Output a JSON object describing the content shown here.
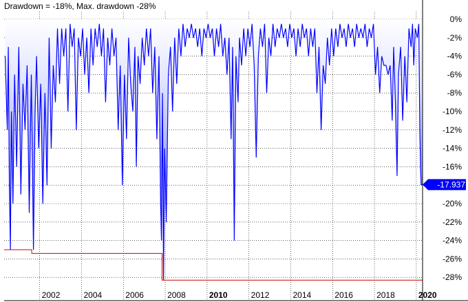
{
  "chart_data": {
    "type": "area",
    "title": "Drawdown = -18%, Max. drawdown -28%",
    "ylim": [
      -28.5,
      0
    ],
    "y_ticks": [
      0,
      -2,
      -4,
      -6,
      -8,
      -10,
      -12,
      -14,
      -16,
      -18,
      -20,
      -22,
      -24,
      -26,
      -28
    ],
    "y_tick_labels": [
      "0%",
      "-2%",
      "-4%",
      "-6%",
      "-8%",
      "-10%",
      "-12%",
      "-14%",
      "-16%",
      "-18%",
      "-20%",
      "-22%",
      "-24%",
      "-26%",
      "-28%"
    ],
    "x_range": [
      2000.3,
      2020.3
    ],
    "x_ticks": [
      2002,
      2004,
      2006,
      2008,
      2010,
      2012,
      2014,
      2016,
      2018,
      2020
    ],
    "x_tick_labels": [
      "2002",
      "2004",
      "2006",
      "2008",
      "2010",
      "2012",
      "2014",
      "2016",
      "2018",
      "2020"
    ],
    "bold_ticks": [
      "2010",
      "2020"
    ],
    "last_value": -17.937,
    "last_value_label": "-17.937",
    "series": [
      {
        "type": "line",
        "color": "#0000FF",
        "points": [
          [
            2000.35,
            -4
          ],
          [
            2000.45,
            -12
          ],
          [
            2000.5,
            -3
          ],
          [
            2000.55,
            -18
          ],
          [
            2000.6,
            -25
          ],
          [
            2000.65,
            -10
          ],
          [
            2000.72,
            -20
          ],
          [
            2000.8,
            -6
          ],
          [
            2000.9,
            -16
          ],
          [
            2001.0,
            -3
          ],
          [
            2001.1,
            -19
          ],
          [
            2001.2,
            -7
          ],
          [
            2001.3,
            -12
          ],
          [
            2001.4,
            -5
          ],
          [
            2001.5,
            -21
          ],
          [
            2001.6,
            -6
          ],
          [
            2001.7,
            -25
          ],
          [
            2001.78,
            -10
          ],
          [
            2001.85,
            -4
          ],
          [
            2001.95,
            -14
          ],
          [
            2002.05,
            -7
          ],
          [
            2002.15,
            -20
          ],
          [
            2002.25,
            -8
          ],
          [
            2002.35,
            -18
          ],
          [
            2002.45,
            -2
          ],
          [
            2002.55,
            -14
          ],
          [
            2002.65,
            -5
          ],
          [
            2002.75,
            -9
          ],
          [
            2002.85,
            -1
          ],
          [
            2002.95,
            -7
          ],
          [
            2003.05,
            -1
          ],
          [
            2003.15,
            -4
          ],
          [
            2003.25,
            -1
          ],
          [
            2003.35,
            -10
          ],
          [
            2003.45,
            -0.5
          ],
          [
            2003.55,
            -3
          ],
          [
            2003.65,
            -1
          ],
          [
            2003.75,
            -12
          ],
          [
            2003.85,
            -2
          ],
          [
            2003.95,
            -4
          ],
          [
            2004.05,
            -1
          ],
          [
            2004.15,
            -6
          ],
          [
            2004.25,
            -2
          ],
          [
            2004.35,
            -8
          ],
          [
            2004.45,
            -1
          ],
          [
            2004.55,
            -5
          ],
          [
            2004.65,
            -1
          ],
          [
            2004.75,
            -3
          ],
          [
            2004.85,
            -0.5
          ],
          [
            2004.95,
            -4
          ],
          [
            2005.05,
            -1
          ],
          [
            2005.15,
            -9
          ],
          [
            2005.25,
            -2
          ],
          [
            2005.35,
            -5
          ],
          [
            2005.45,
            -1
          ],
          [
            2005.55,
            -4
          ],
          [
            2005.65,
            -2
          ],
          [
            2005.75,
            -12
          ],
          [
            2005.85,
            -5
          ],
          [
            2005.95,
            -18
          ],
          [
            2006.05,
            -6
          ],
          [
            2006.15,
            -13
          ],
          [
            2006.25,
            -2
          ],
          [
            2006.35,
            -7
          ],
          [
            2006.45,
            -10
          ],
          [
            2006.55,
            -3
          ],
          [
            2006.62,
            -16
          ],
          [
            2006.7,
            -4
          ],
          [
            2006.8,
            -7
          ],
          [
            2006.9,
            -2
          ],
          [
            2007.0,
            -5
          ],
          [
            2007.1,
            -1
          ],
          [
            2007.2,
            -4
          ],
          [
            2007.3,
            -1
          ],
          [
            2007.4,
            -8
          ],
          [
            2007.5,
            -3
          ],
          [
            2007.6,
            -13
          ],
          [
            2007.7,
            -4
          ],
          [
            2007.78,
            -20
          ],
          [
            2007.82,
            -24
          ],
          [
            2007.87,
            -8
          ],
          [
            2007.92,
            -28.3
          ],
          [
            2007.97,
            -14
          ],
          [
            2008.05,
            -22
          ],
          [
            2008.15,
            -6
          ],
          [
            2008.25,
            -3
          ],
          [
            2008.35,
            -10
          ],
          [
            2008.45,
            -2
          ],
          [
            2008.55,
            -7
          ],
          [
            2008.65,
            -1
          ],
          [
            2008.75,
            -4
          ],
          [
            2008.85,
            -0.5
          ],
          [
            2008.95,
            -3
          ],
          [
            2009.05,
            -1
          ],
          [
            2009.15,
            -2
          ],
          [
            2009.25,
            -0.5
          ],
          [
            2009.35,
            -2
          ],
          [
            2009.45,
            -1
          ],
          [
            2009.55,
            -3
          ],
          [
            2009.65,
            -1
          ],
          [
            2009.75,
            -4
          ],
          [
            2009.85,
            -1
          ],
          [
            2009.95,
            -2
          ],
          [
            2010.05,
            -0.5
          ],
          [
            2010.15,
            -2
          ],
          [
            2010.25,
            -1
          ],
          [
            2010.35,
            -4
          ],
          [
            2010.45,
            -1
          ],
          [
            2010.55,
            -3
          ],
          [
            2010.65,
            -0.5
          ],
          [
            2010.75,
            -4
          ],
          [
            2010.85,
            -2
          ],
          [
            2010.95,
            -6
          ],
          [
            2011.05,
            -2
          ],
          [
            2011.15,
            -13
          ],
          [
            2011.22,
            -3
          ],
          [
            2011.3,
            -24
          ],
          [
            2011.38,
            -4
          ],
          [
            2011.48,
            -9
          ],
          [
            2011.55,
            -2
          ],
          [
            2011.65,
            -5
          ],
          [
            2011.75,
            -1
          ],
          [
            2011.85,
            -4
          ],
          [
            2011.95,
            -1
          ],
          [
            2012.05,
            -3
          ],
          [
            2012.15,
            -0.5
          ],
          [
            2012.25,
            -5
          ],
          [
            2012.35,
            -15
          ],
          [
            2012.45,
            -4
          ],
          [
            2012.55,
            -1
          ],
          [
            2012.65,
            -3
          ],
          [
            2012.75,
            -0.5
          ],
          [
            2012.85,
            -8
          ],
          [
            2012.95,
            -2
          ],
          [
            2013.05,
            -4
          ],
          [
            2013.15,
            -0.5
          ],
          [
            2013.25,
            -3
          ],
          [
            2013.35,
            -1
          ],
          [
            2013.45,
            -2
          ],
          [
            2013.55,
            -0.5
          ],
          [
            2013.65,
            -2
          ],
          [
            2013.75,
            -1
          ],
          [
            2013.85,
            -3
          ],
          [
            2013.95,
            -0.5
          ],
          [
            2014.05,
            -2
          ],
          [
            2014.15,
            -1
          ],
          [
            2014.25,
            -4
          ],
          [
            2014.35,
            -1
          ],
          [
            2014.45,
            -3
          ],
          [
            2014.55,
            -0.5
          ],
          [
            2014.65,
            -2
          ],
          [
            2014.75,
            -1
          ],
          [
            2014.85,
            -4
          ],
          [
            2014.95,
            -1
          ],
          [
            2015.05,
            -3
          ],
          [
            2015.15,
            -1
          ],
          [
            2015.25,
            -8
          ],
          [
            2015.35,
            -3
          ],
          [
            2015.45,
            -12
          ],
          [
            2015.55,
            -5
          ],
          [
            2015.65,
            -7
          ],
          [
            2015.75,
            -2
          ],
          [
            2015.85,
            -5
          ],
          [
            2015.95,
            -1
          ],
          [
            2016.05,
            -4
          ],
          [
            2016.15,
            -1
          ],
          [
            2016.25,
            -3
          ],
          [
            2016.35,
            -0.5
          ],
          [
            2016.45,
            -2
          ],
          [
            2016.55,
            -1
          ],
          [
            2016.65,
            -3
          ],
          [
            2016.75,
            -0.5
          ],
          [
            2016.85,
            -2
          ],
          [
            2016.95,
            -1
          ],
          [
            2017.05,
            -3
          ],
          [
            2017.15,
            -0.5
          ],
          [
            2017.25,
            -2
          ],
          [
            2017.35,
            -1
          ],
          [
            2017.45,
            -2
          ],
          [
            2017.55,
            -0.5
          ],
          [
            2017.65,
            -3
          ],
          [
            2017.75,
            -1
          ],
          [
            2017.85,
            -2
          ],
          [
            2017.95,
            -0.5
          ],
          [
            2018.05,
            -6
          ],
          [
            2018.15,
            -3
          ],
          [
            2018.25,
            -8
          ],
          [
            2018.35,
            -4
          ],
          [
            2018.45,
            -5
          ],
          [
            2018.55,
            -5
          ],
          [
            2018.65,
            -6
          ],
          [
            2018.75,
            -5
          ],
          [
            2018.85,
            -11
          ],
          [
            2018.92,
            -3
          ],
          [
            2019.0,
            -9
          ],
          [
            2019.08,
            -17
          ],
          [
            2019.15,
            -6
          ],
          [
            2019.25,
            -3
          ],
          [
            2019.35,
            -11
          ],
          [
            2019.45,
            -4
          ],
          [
            2019.55,
            -9
          ],
          [
            2019.65,
            -1
          ],
          [
            2019.75,
            -3
          ],
          [
            2019.82,
            -0.5
          ],
          [
            2019.88,
            -5
          ],
          [
            2019.95,
            -1
          ],
          [
            2020.05,
            -2
          ],
          [
            2020.12,
            -0.5
          ],
          [
            2020.17,
            -12
          ],
          [
            2020.2,
            -16
          ],
          [
            2020.23,
            -17.937
          ],
          [
            2020.3,
            -17.937
          ]
        ]
      },
      {
        "type": "step",
        "color": "#CC0000",
        "name": "max drawdown",
        "points": [
          [
            2000.3,
            -25
          ],
          [
            2001.62,
            -25
          ],
          [
            2001.62,
            -25.4
          ],
          [
            2007.85,
            -25.4
          ],
          [
            2007.85,
            -28.3
          ],
          [
            2020.3,
            -28.3
          ]
        ]
      }
    ]
  }
}
